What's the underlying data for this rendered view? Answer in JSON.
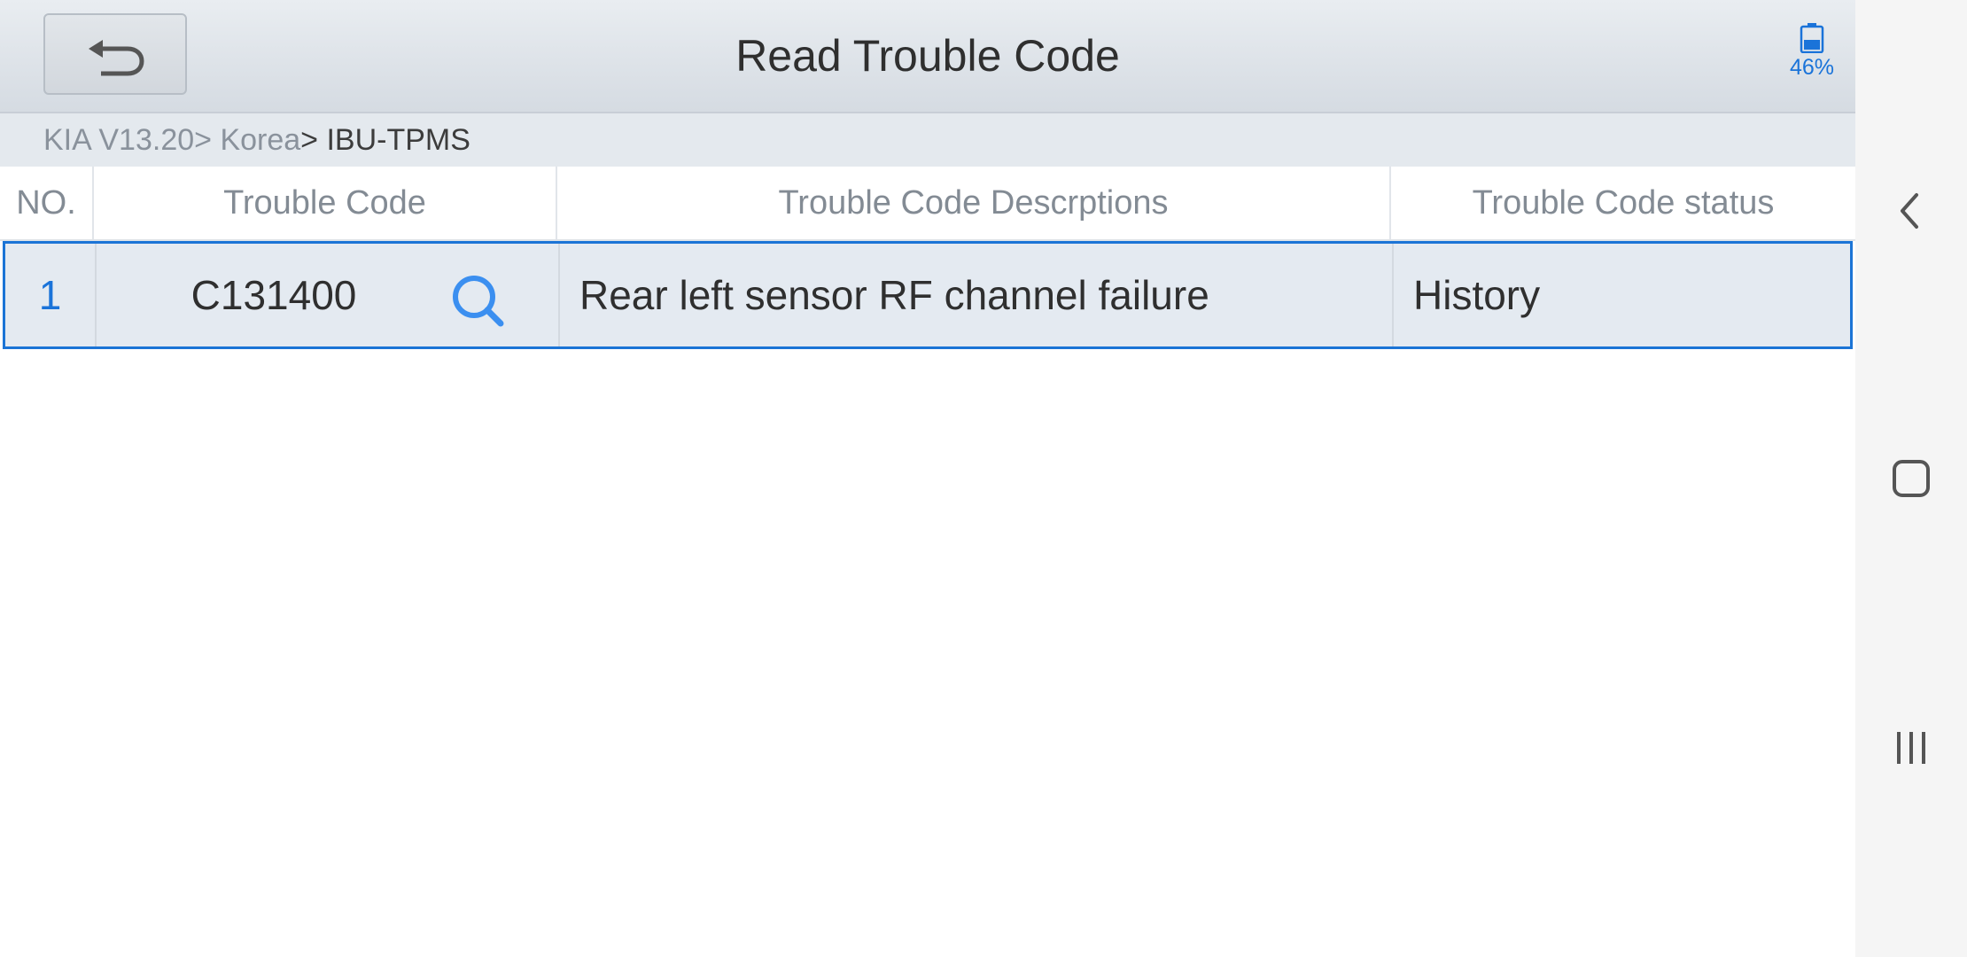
{
  "header": {
    "title": "Read Trouble Code",
    "battery": "46%",
    "back_icon": "back-arrow-icon",
    "battery_icon": "battery-icon"
  },
  "breadcrumb": {
    "part1": "KIA V13.20",
    "part2": "> Korea",
    "part3": "> IBU-TPMS"
  },
  "table": {
    "headers": [
      "NO.",
      "Trouble Code",
      "Trouble Code Descrptions",
      "Trouble Code status"
    ],
    "rows": [
      {
        "no": "1",
        "code": "C131400",
        "description": "Rear left sensor RF channel failure",
        "status": "History"
      }
    ]
  },
  "navbar": {
    "back_icon": "chevron-left-icon",
    "home_icon": "home-square-icon",
    "recents_icon": "recents-icon"
  },
  "colors": {
    "accent": "#1a73d9",
    "selected_row_bg": "#e4eaf1",
    "header_bg": "#dde2e8"
  }
}
